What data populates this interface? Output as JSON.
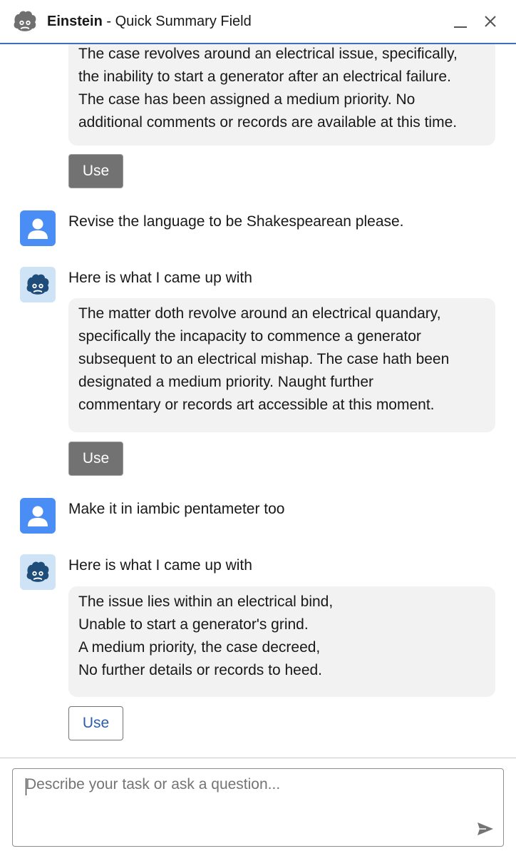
{
  "header": {
    "app_name": "Einstein",
    "separator": " - ",
    "subtitle": "Quick Summary Field",
    "minimize_icon": "minimize-icon",
    "close_icon": "close-icon"
  },
  "messages": [
    {
      "type": "assistant_response",
      "lines": [
        "The case revolves around an electrical issue, specifically,",
        "the inability to start a generator after an electrical failure.",
        "The case has been assigned a medium priority. No",
        "additional comments or records are available at this time."
      ],
      "button_label": "Use"
    },
    {
      "type": "user",
      "avatar_icon": "user-icon",
      "text": "Revise the language to be Shakespearean please."
    },
    {
      "type": "assistant",
      "avatar_icon": "einstein-icon",
      "intro": "Here is what I came up with",
      "lines": [
        "The matter doth revolve around an electrical quandary,",
        "specifically the incapacity to commence a generator",
        "subsequent to an electrical mishap. The case hath been",
        "designated a medium priority. Naught further",
        "commentary or records art accessible at this moment."
      ],
      "button_label": "Use"
    },
    {
      "type": "user",
      "avatar_icon": "user-icon",
      "text": "Make it in iambic pentameter too"
    },
    {
      "type": "assistant",
      "avatar_icon": "einstein-icon",
      "intro": "Here is what I came up with",
      "lines": [
        "The issue lies within an electrical bind,",
        "Unable to start a generator's grind.",
        "A medium priority, the case decreed,",
        "No further details or records to heed."
      ],
      "button_label": "Use"
    }
  ],
  "composer": {
    "placeholder": "Describe your task or ask a question...",
    "send_icon": "send-icon"
  },
  "colors": {
    "header_border": "#3b6fc2",
    "user_avatar": "#4a8df5",
    "bot_avatar": "#cfe3f7",
    "bubble": "#f2f2f2",
    "use_filled": "#727272",
    "use_outline_text": "#2a5db0"
  }
}
